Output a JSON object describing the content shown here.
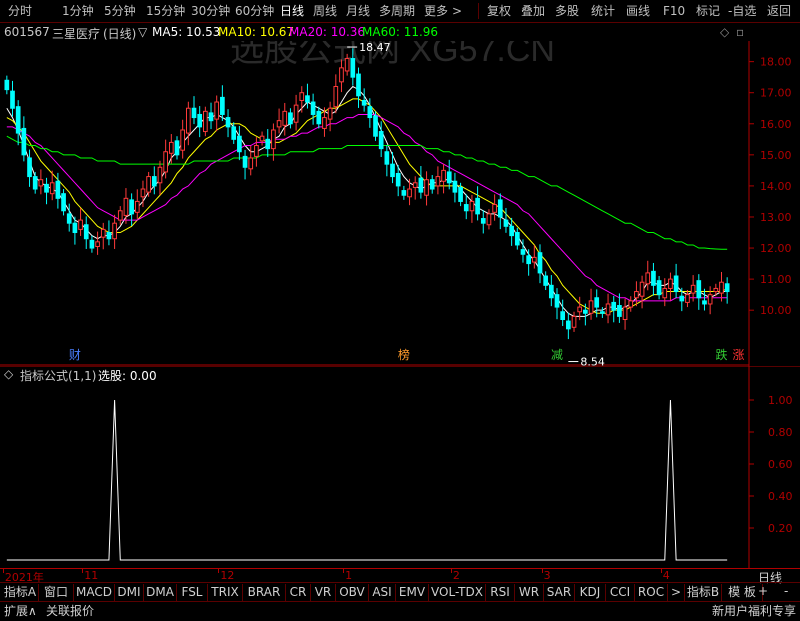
{
  "top_menu": {
    "periods": [
      "分时",
      "1分钟",
      "5分钟",
      "15分钟",
      "30分钟",
      "60分钟",
      "日线",
      "周线",
      "月线",
      "多周期",
      "更多"
    ],
    "more_arrow": ">",
    "tools": [
      "复权",
      "叠加",
      "多股",
      "统计",
      "画线",
      "F10",
      "标记",
      "-自选",
      "返回"
    ]
  },
  "stock": {
    "code": "601567",
    "name": "三星医疗",
    "period": "(日线)"
  },
  "ma_legend": [
    {
      "label": "MA5: 10.53",
      "color": "#ffffff"
    },
    {
      "label": "MA10: 10.67",
      "color": "#ffff00"
    },
    {
      "label": "MA20: 10.36",
      "color": "#ff00ff"
    },
    {
      "label": "MA60: 11.96",
      "color": "#00ff00"
    }
  ],
  "watermark": "选股公式网 XG57.CN",
  "chart_data": [
    {
      "type": "candlestick",
      "title": "601567 三星医疗 (日线)",
      "ylim": [
        8.3,
        18.6
      ],
      "y_ticks": [
        10.0,
        11.0,
        12.0,
        13.0,
        14.0,
        15.0,
        16.0,
        17.0,
        18.0
      ],
      "y_tick_labels": [
        "10.00",
        "11.00",
        "12.00",
        "13.00",
        "14.00",
        "15.00",
        "16.00",
        "17.00",
        "18.00"
      ],
      "annotations": [
        {
          "text": "18.47",
          "value": 18.47,
          "marker": "high"
        },
        {
          "text": "8.54",
          "value": 8.54,
          "marker": "low"
        }
      ],
      "event_markers": [
        {
          "text": "财",
          "color": "#4a7fff",
          "index": 12
        },
        {
          "text": "榜",
          "color": "#ff9a2a",
          "index": 70
        },
        {
          "text": "减",
          "color": "#33cc33",
          "index": 97
        },
        {
          "text": "跌",
          "color": "#33cc33",
          "index": 126
        },
        {
          "text": "涨",
          "color": "#ff3333",
          "index": 129
        }
      ],
      "closes": [
        17.1,
        16.5,
        15.7,
        15.0,
        14.3,
        13.9,
        14.2,
        13.8,
        14.1,
        13.6,
        13.2,
        12.8,
        12.5,
        12.9,
        12.3,
        12.0,
        12.2,
        12.6,
        12.3,
        12.8,
        13.2,
        13.6,
        13.1,
        13.5,
        13.9,
        14.3,
        14.0,
        14.6,
        15.1,
        15.4,
        15.0,
        15.8,
        16.5,
        16.2,
        15.9,
        16.4,
        16.1,
        16.7,
        16.3,
        15.9,
        15.5,
        15.1,
        14.6,
        14.9,
        15.3,
        15.6,
        15.2,
        15.8,
        16.1,
        16.4,
        16.0,
        16.6,
        17.0,
        16.7,
        16.3,
        16.0,
        16.2,
        16.5,
        17.2,
        17.8,
        18.1,
        17.5,
        16.9,
        16.6,
        16.2,
        15.6,
        15.2,
        14.7,
        14.3,
        14.0,
        13.7,
        13.9,
        14.1,
        13.8,
        14.2,
        13.9,
        14.3,
        14.5,
        14.1,
        13.8,
        13.5,
        13.2,
        13.5,
        13.1,
        12.8,
        13.1,
        13.4,
        13.0,
        12.7,
        12.4,
        12.1,
        11.8,
        11.5,
        11.7,
        11.2,
        10.8,
        10.4,
        10.1,
        9.7,
        9.4,
        9.8,
        10.1,
        9.9,
        10.3,
        10.1,
        9.9,
        10.2,
        10.0,
        9.8,
        10.1,
        10.3,
        10.6,
        10.9,
        11.2,
        10.8,
        10.5,
        10.7,
        11.0,
        10.6,
        10.3,
        10.5,
        10.8,
        10.4,
        10.2,
        10.5,
        10.7,
        10.9,
        10.6
      ],
      "ma": [
        {
          "name": "MA5",
          "color": "#ffffff",
          "values": [
            16.5,
            16.2,
            15.8,
            15.3,
            14.8,
            14.3,
            14.1,
            14.0,
            13.9,
            13.8,
            13.5,
            13.2,
            12.9,
            12.8,
            12.6,
            12.4,
            12.3,
            12.4,
            12.4,
            12.5,
            12.7,
            13.0,
            13.1,
            13.3,
            13.5,
            13.8,
            14.0,
            14.2,
            14.5,
            14.9,
            15.1,
            15.4,
            15.6,
            15.8,
            16.0,
            16.2,
            16.2,
            16.3,
            16.2,
            16.1,
            15.9,
            15.6,
            15.3,
            15.1,
            15.1,
            15.2,
            15.3,
            15.5,
            15.6,
            15.9,
            16.0,
            16.3,
            16.5,
            16.7,
            16.6,
            16.5,
            16.4,
            16.3,
            16.4,
            16.7,
            17.0,
            17.2,
            17.1,
            16.9,
            16.6,
            16.2,
            15.8,
            15.4,
            15.0,
            14.6,
            14.3,
            14.1,
            14.0,
            13.9,
            14.0,
            14.1,
            14.1,
            14.2,
            14.2,
            14.1,
            13.9,
            13.7,
            13.5,
            13.3,
            13.2,
            13.1,
            13.1,
            13.0,
            12.9,
            12.7,
            12.4,
            12.1,
            11.8,
            11.6,
            11.3,
            11.0,
            10.7,
            10.4,
            10.1,
            9.9,
            9.8,
            9.8,
            9.8,
            9.9,
            10.0,
            10.0,
            10.1,
            10.1,
            10.0,
            10.1,
            10.2,
            10.4,
            10.6,
            10.9,
            10.9,
            10.8,
            10.8,
            10.9,
            10.8,
            10.6,
            10.5,
            10.6,
            10.6,
            10.5,
            10.4,
            10.5,
            10.6,
            10.6
          ],
          "sample_values": "MA values approximated from screenshot"
        },
        {
          "name": "MA10",
          "color": "#ffff00",
          "values": [
            16.2,
            16.1,
            15.9,
            15.7,
            15.4,
            15.1,
            14.8,
            14.6,
            14.4,
            14.2,
            14.0,
            13.8,
            13.5,
            13.3,
            13.1,
            12.9,
            12.7,
            12.6,
            12.5,
            12.5,
            12.5,
            12.6,
            12.7,
            12.9,
            13.1,
            13.3,
            13.5,
            13.7,
            13.9,
            14.1,
            14.4,
            14.6,
            14.9,
            15.1,
            15.3,
            15.5,
            15.6,
            15.8,
            15.9,
            16.0,
            16.0,
            16.0,
            15.9,
            15.7,
            15.6,
            15.5,
            15.4,
            15.4,
            15.4,
            15.5,
            15.6,
            15.7,
            15.9,
            16.1,
            16.2,
            16.3,
            16.4,
            16.5,
            16.5,
            16.6,
            16.7,
            16.8,
            16.8,
            16.7,
            16.6,
            16.4,
            16.2,
            15.9,
            15.6,
            15.3,
            15.0,
            14.7,
            14.5,
            14.3,
            14.1,
            14.0,
            14.0,
            14.0,
            14.0,
            14.0,
            14.0,
            13.9,
            13.8,
            13.7,
            13.6,
            13.5,
            13.4,
            13.3,
            13.1,
            12.9,
            12.7,
            12.5,
            12.3,
            12.1,
            11.8,
            11.6,
            11.3,
            11.1,
            10.8,
            10.6,
            10.4,
            10.2,
            10.1,
            10.0,
            9.9,
            9.9,
            9.9,
            10.0,
            10.0,
            10.0,
            10.1,
            10.2,
            10.3,
            10.4,
            10.5,
            10.5,
            10.6,
            10.6,
            10.6,
            10.6,
            10.6,
            10.6,
            10.6,
            10.6,
            10.6,
            10.6,
            10.6,
            10.7
          ],
          "sample_values": "MA values approximated from screenshot"
        },
        {
          "name": "MA20",
          "color": "#ff00ff",
          "values": [
            15.9,
            15.9,
            15.8,
            15.7,
            15.6,
            15.4,
            15.3,
            15.1,
            14.9,
            14.7,
            14.5,
            14.3,
            14.1,
            13.9,
            13.7,
            13.5,
            13.3,
            13.2,
            13.1,
            13.0,
            12.9,
            12.9,
            12.9,
            12.9,
            13.0,
            13.1,
            13.2,
            13.3,
            13.4,
            13.6,
            13.7,
            13.9,
            14.0,
            14.2,
            14.4,
            14.5,
            14.7,
            14.8,
            14.9,
            15.0,
            15.1,
            15.2,
            15.3,
            15.3,
            15.4,
            15.4,
            15.4,
            15.5,
            15.5,
            15.5,
            15.6,
            15.6,
            15.7,
            15.7,
            15.8,
            15.9,
            15.9,
            16.0,
            16.0,
            16.1,
            16.2,
            16.2,
            16.3,
            16.3,
            16.3,
            16.3,
            16.2,
            16.1,
            16.0,
            15.9,
            15.7,
            15.6,
            15.4,
            15.3,
            15.1,
            15.0,
            14.8,
            14.7,
            14.6,
            14.5,
            14.4,
            14.3,
            14.2,
            14.1,
            14.0,
            13.9,
            13.8,
            13.7,
            13.6,
            13.5,
            13.4,
            13.2,
            13.1,
            12.9,
            12.7,
            12.5,
            12.3,
            12.1,
            11.9,
            11.7,
            11.5,
            11.3,
            11.1,
            11.0,
            10.8,
            10.7,
            10.6,
            10.5,
            10.4,
            10.4,
            10.3,
            10.3,
            10.3,
            10.3,
            10.3,
            10.3,
            10.3,
            10.3,
            10.4,
            10.4,
            10.4,
            10.4,
            10.4,
            10.4,
            10.4,
            10.4,
            10.4,
            10.4
          ],
          "sample_values": "MA values approximated from screenshot"
        },
        {
          "name": "MA60",
          "color": "#00ff00",
          "values": [
            15.6,
            15.5,
            15.4,
            15.4,
            15.3,
            15.3,
            15.2,
            15.2,
            15.1,
            15.1,
            15.0,
            15.0,
            15.0,
            14.9,
            14.9,
            14.9,
            14.8,
            14.8,
            14.8,
            14.8,
            14.7,
            14.7,
            14.7,
            14.7,
            14.7,
            14.7,
            14.7,
            14.7,
            14.7,
            14.7,
            14.7,
            14.7,
            14.7,
            14.8,
            14.8,
            14.8,
            14.8,
            14.8,
            14.8,
            14.8,
            14.9,
            14.9,
            14.9,
            14.9,
            14.9,
            15.0,
            15.0,
            15.0,
            15.0,
            15.0,
            15.1,
            15.1,
            15.1,
            15.1,
            15.1,
            15.2,
            15.2,
            15.2,
            15.2,
            15.2,
            15.3,
            15.3,
            15.3,
            15.3,
            15.3,
            15.3,
            15.3,
            15.3,
            15.3,
            15.3,
            15.3,
            15.3,
            15.3,
            15.3,
            15.2,
            15.2,
            15.2,
            15.1,
            15.1,
            15.0,
            15.0,
            14.9,
            14.9,
            14.8,
            14.8,
            14.7,
            14.7,
            14.6,
            14.6,
            14.5,
            14.5,
            14.4,
            14.3,
            14.3,
            14.2,
            14.1,
            14.0,
            14.0,
            13.9,
            13.8,
            13.7,
            13.6,
            13.5,
            13.4,
            13.3,
            13.2,
            13.1,
            13.0,
            12.9,
            12.8,
            12.8,
            12.7,
            12.6,
            12.5,
            12.5,
            12.4,
            12.3,
            12.3,
            12.2,
            12.2,
            12.1,
            12.1,
            12.0,
            12.0,
            11.98,
            11.97,
            11.96,
            11.96
          ],
          "sample_values": "MA values approximated from screenshot"
        }
      ]
    },
    {
      "type": "line",
      "title": "指标公式(1,1) 选股: 0.00",
      "ylim": [
        0,
        1.1
      ],
      "y_ticks": [
        0.2,
        0.4,
        0.6,
        0.8,
        1.0
      ],
      "y_tick_labels": [
        "0.20",
        "0.40",
        "0.60",
        "0.80",
        "1.00"
      ],
      "signal_indices": [
        19,
        117
      ],
      "series": [
        {
          "color": "#ffffff"
        }
      ]
    }
  ],
  "indicator": {
    "title": "指标公式(1,1)",
    "value_label": "选股: 0.00"
  },
  "time_axis": {
    "labels": [
      {
        "text": "2021年",
        "index": 0
      },
      {
        "text": "11",
        "index": 14
      },
      {
        "text": "12",
        "index": 38
      },
      {
        "text": "1",
        "index": 60
      },
      {
        "text": "2",
        "index": 79
      },
      {
        "text": "3",
        "index": 95
      },
      {
        "text": "4",
        "index": 116
      }
    ]
  },
  "indicator_tabs": [
    "指标A",
    "窗口",
    "MACD",
    "DMI",
    "DMA",
    "FSL",
    "TRIX",
    "BRAR",
    "CR",
    "VR",
    "OBV",
    "ASI",
    "EMV",
    "VOL-TDX",
    "RSI",
    "WR",
    "SAR",
    "KDJ",
    "CCI",
    "ROC",
    ">",
    "指标B",
    "模 板"
  ],
  "period_status": "日线",
  "bottom": {
    "expand": "扩展∧",
    "related": "关联报价",
    "plus": "+",
    "minus": "-",
    "promo": "新用户福利专享"
  },
  "colors": {
    "up": "#ff3a3a",
    "down": "#00ffff",
    "axis": "#b00000",
    "grid": "#5a0000"
  }
}
